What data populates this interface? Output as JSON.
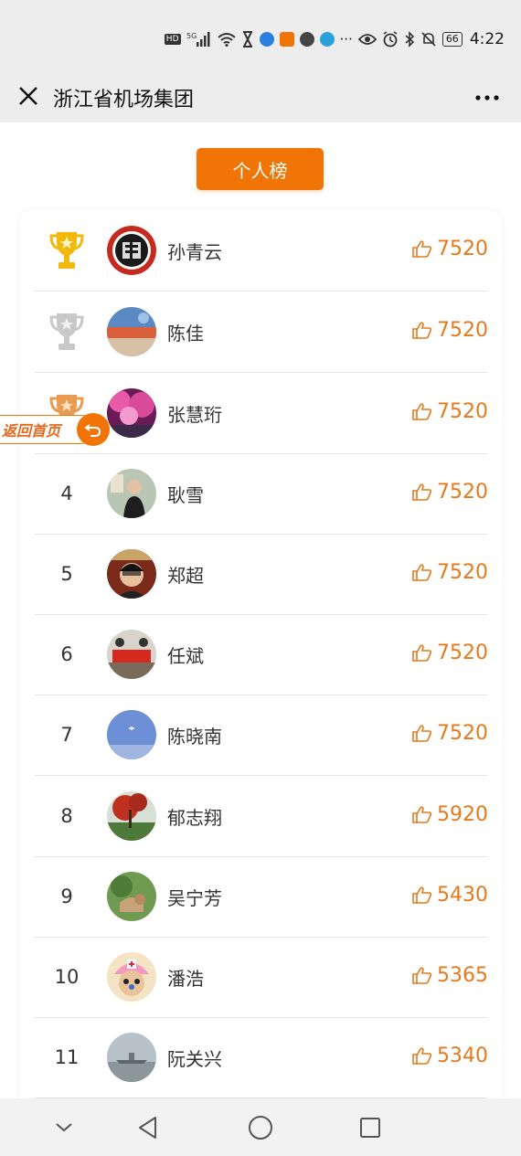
{
  "status_bar": {
    "network": "HD",
    "signal_label": "5G",
    "battery": "66",
    "time": "4:22",
    "overflow": "···"
  },
  "title_bar": {
    "title": "浙江省机场集团"
  },
  "main": {
    "tab_label": "个人榜",
    "back_home_label": "返回首页",
    "rows": [
      {
        "rank": "",
        "medal": "gold-trophy-icon",
        "name": "孙青云",
        "score": "7520"
      },
      {
        "rank": "",
        "medal": "silver-trophy-icon",
        "name": "陈佳",
        "score": "7520"
      },
      {
        "rank": "",
        "medal": "bronze-trophy-icon",
        "name": "张慧珩",
        "score": "7520"
      },
      {
        "rank": "4",
        "medal": "",
        "name": "耿雪",
        "score": "7520"
      },
      {
        "rank": "5",
        "medal": "",
        "name": "郑超",
        "score": "7520"
      },
      {
        "rank": "6",
        "medal": "",
        "name": "任斌",
        "score": "7520"
      },
      {
        "rank": "7",
        "medal": "",
        "name": "陈晓南",
        "score": "7520"
      },
      {
        "rank": "8",
        "medal": "",
        "name": "郁志翔",
        "score": "5920"
      },
      {
        "rank": "9",
        "medal": "",
        "name": "吴宁芳",
        "score": "5430"
      },
      {
        "rank": "10",
        "medal": "",
        "name": "潘浩",
        "score": "5365"
      },
      {
        "rank": "11",
        "medal": "",
        "name": "阮关兴",
        "score": "5340"
      }
    ]
  },
  "colors": {
    "accent": "#f07406",
    "score": "#e37a1d",
    "gold": "#f2b90c",
    "silver": "#c8c8c8",
    "bronze": "#e99b52"
  }
}
